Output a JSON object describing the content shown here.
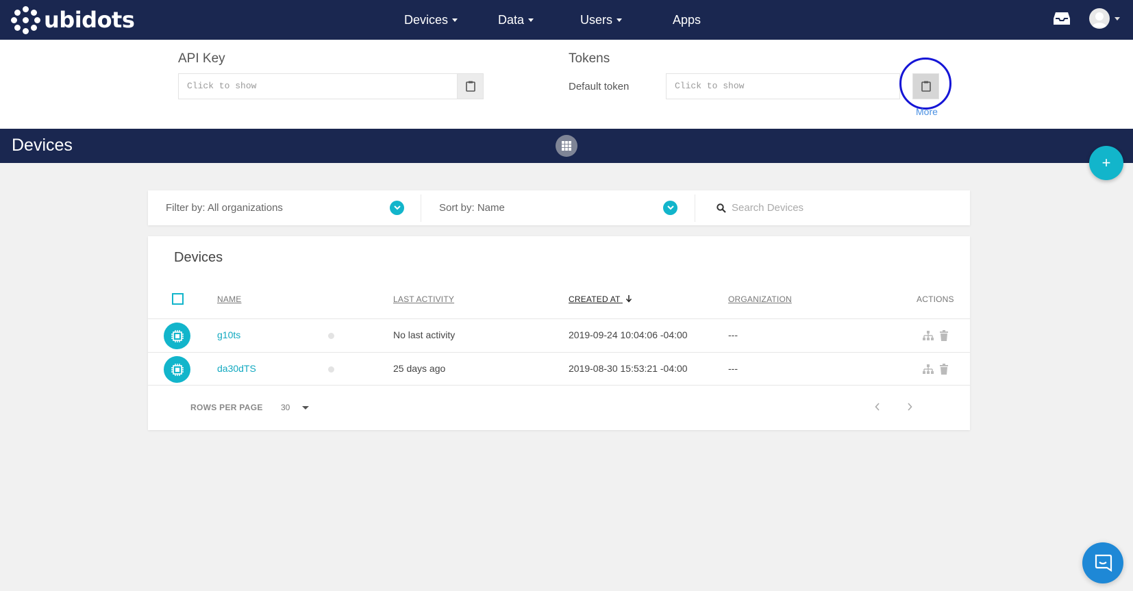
{
  "brand": {
    "name": "ubidots"
  },
  "nav": {
    "items": [
      {
        "label": "Devices",
        "dropdown": true
      },
      {
        "label": "Data",
        "dropdown": true
      },
      {
        "label": "Users",
        "dropdown": true
      },
      {
        "label": "Apps",
        "dropdown": false
      }
    ]
  },
  "credentials": {
    "api_key_title": "API Key",
    "api_key_placeholder": "Click to show",
    "tokens_title": "Tokens",
    "default_token_label": "Default token",
    "token_placeholder": "Click to show",
    "more_label": "More"
  },
  "devices_header": {
    "title": "Devices"
  },
  "filters": {
    "filter_label": "Filter by: All organizations",
    "sort_label": "Sort by: Name",
    "search_placeholder": "Search Devices"
  },
  "table": {
    "title": "Devices",
    "columns": {
      "name": "NAME",
      "last_activity": "LAST ACTIVITY",
      "created_at": "CREATED AT",
      "organization": "ORGANIZATION",
      "actions": "ACTIONS"
    },
    "rows": [
      {
        "name": "g10ts",
        "last_activity": "No last activity",
        "created_at": "2019-09-24 10:04:06 -04:00",
        "organization": "---"
      },
      {
        "name": "da30dTS",
        "last_activity": "25 days ago",
        "created_at": "2019-08-30 15:53:21 -04:00",
        "organization": "---"
      }
    ],
    "rows_per_page_label": "ROWS PER PAGE",
    "rows_per_page_value": "30"
  },
  "colors": {
    "nav_bg": "#1a2750",
    "accent": "#12b5cb",
    "highlight_ring": "#1515d6",
    "link": "#4a90e2",
    "chat": "#1e88d6"
  },
  "icons": {
    "inbox": "inbox-icon",
    "avatar": "user-avatar-icon",
    "copy": "clipboard-icon",
    "grid": "grid-icon",
    "add": "plus-icon",
    "chevron": "chevron-down-icon",
    "search": "search-icon",
    "device": "chip-icon",
    "hierarchy": "hierarchy-icon",
    "delete": "trash-icon",
    "chat": "chat-icon"
  }
}
